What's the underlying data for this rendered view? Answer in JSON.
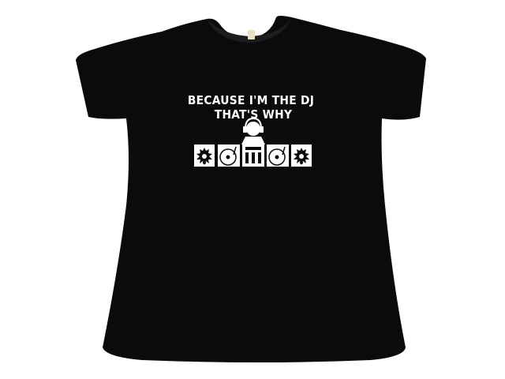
{
  "shirt": {
    "color": "#0b0b0b",
    "tag_color": "#e8e2c4",
    "print_color": "#ffffff"
  },
  "print": {
    "line_1": "BECAUSE I'M THE DJ",
    "line_2": "THAT'S WHY",
    "icons": [
      "speaker-icon",
      "turntable-icon",
      "dj-figure-icon",
      "mixer-icon",
      "turntable-icon",
      "speaker-icon"
    ]
  }
}
